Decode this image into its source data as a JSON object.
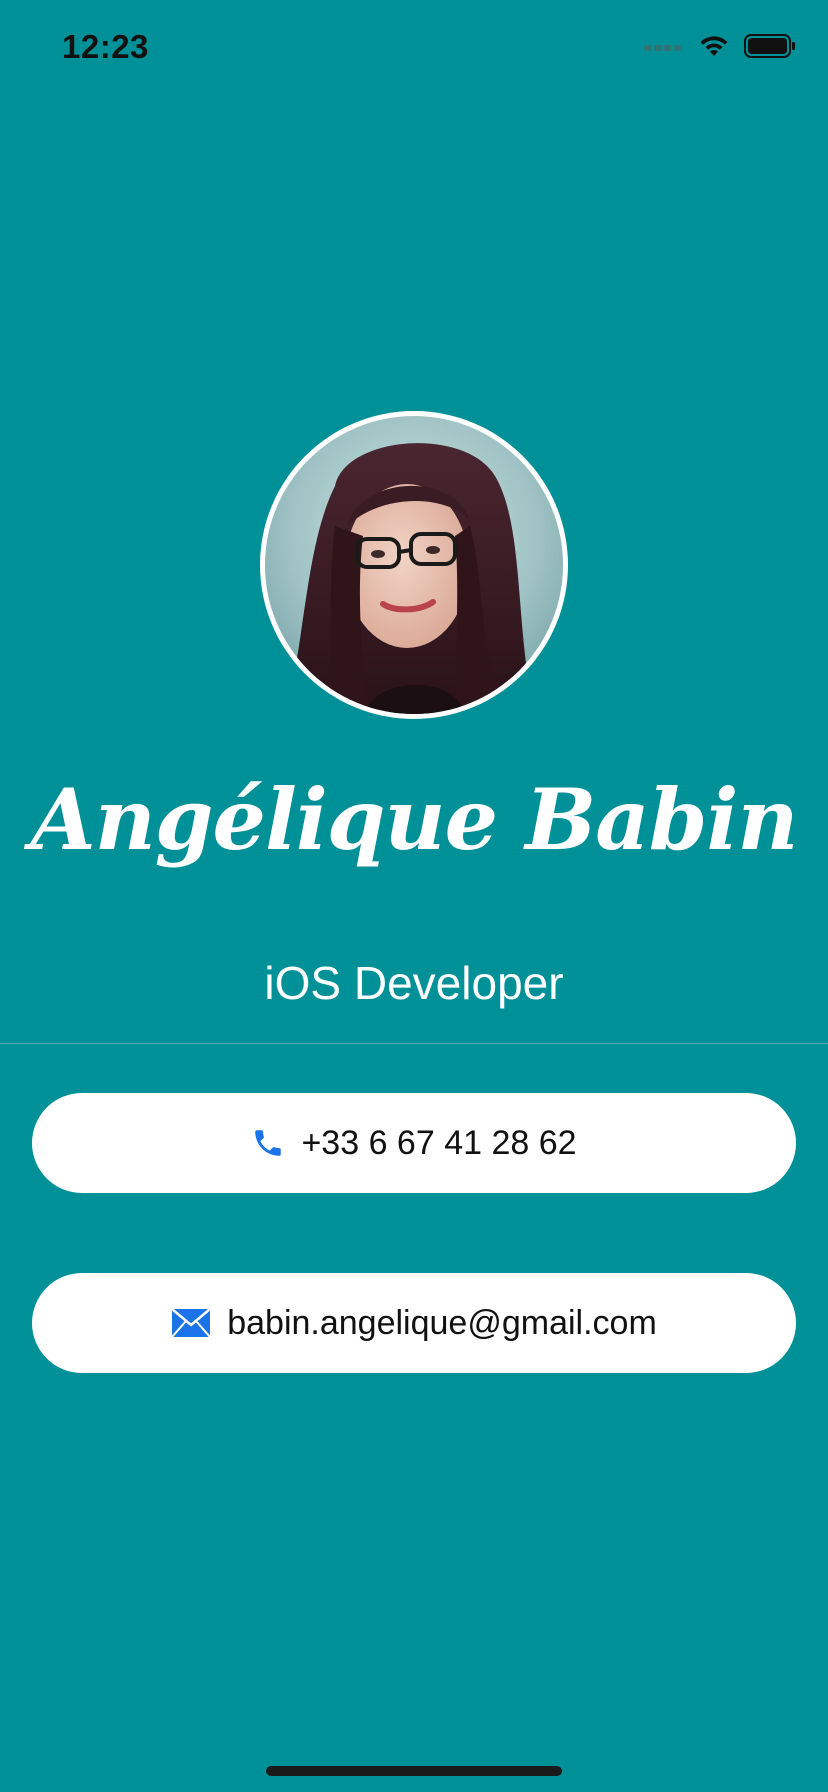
{
  "status_bar": {
    "time": "12:23",
    "icons": [
      "cellular-signal-icon",
      "wifi-icon",
      "battery-icon"
    ]
  },
  "profile": {
    "name": "Angélique Babin",
    "title": "iOS Developer"
  },
  "contacts": {
    "phone": {
      "icon": "phone-icon",
      "text": "+33 6 67 41 28 62"
    },
    "email": {
      "icon": "envelope-icon",
      "text": "babin.angelique@gmail.com"
    }
  },
  "colors": {
    "background": "#009098",
    "pill_background": "#ffffff",
    "icon_accent": "#1a73e8",
    "text_light": "#ffffff",
    "text_dark": "#111111"
  }
}
